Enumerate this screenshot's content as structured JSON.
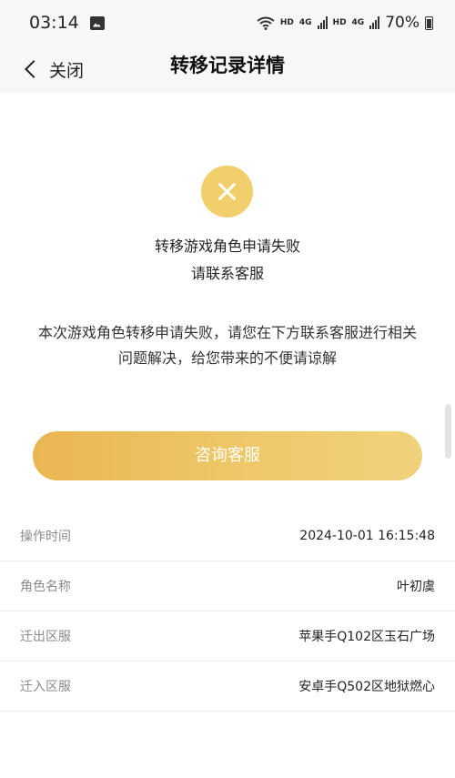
{
  "status_bar": {
    "time": "03:14",
    "battery": "70%",
    "tag_hd_1": "HD",
    "tag_4g_1": "4G",
    "tag_hd_2": "HD",
    "tag_4g_2": "4G"
  },
  "header": {
    "back_label": "关闭",
    "title": "转移记录详情"
  },
  "result": {
    "icon": "close-x-icon",
    "title_line1": "转移游戏角色申请失败",
    "title_line2": "请联系客服",
    "description": "本次游戏角色转移申请失败，请您在下方联系客服进行相关问题解决，给您带来的不便请谅解",
    "consult_button": "咨询客服"
  },
  "details": [
    {
      "label": "操作时间",
      "value": "2024-10-01 16:15:48"
    },
    {
      "label": "角色名称",
      "value": "叶初虞"
    },
    {
      "label": "迁出区服",
      "value": "苹果手Q102区玉石广场"
    },
    {
      "label": "迁入区服",
      "value": "安卓手Q502区地狱燃心"
    }
  ],
  "colors": {
    "accent": "#f1cf6c",
    "button_gradient_start": "#e9b652",
    "button_gradient_end": "#f0d27c",
    "header_bg": "#f6f7f9"
  }
}
